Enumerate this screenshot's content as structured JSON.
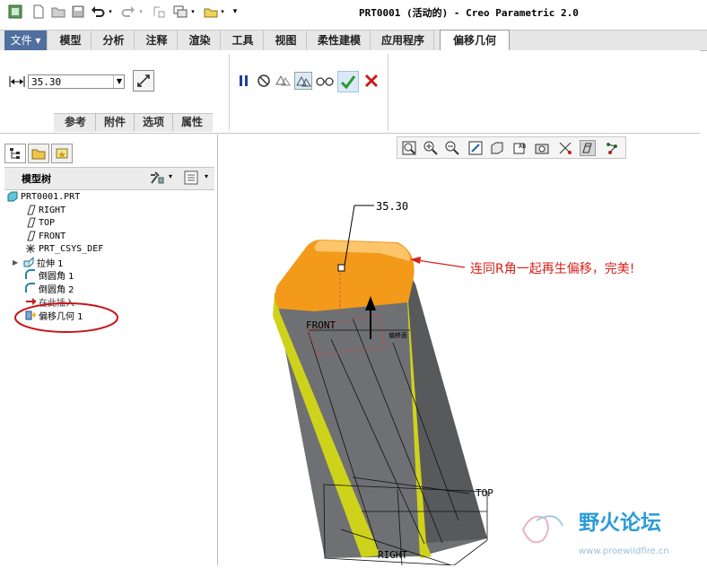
{
  "window": {
    "title": "PRT0001 (活动的) - Creo Parametric 2.0"
  },
  "ribbon_tabs": [
    {
      "label": "文件 ▾"
    },
    {
      "label": "模型"
    },
    {
      "label": "分析"
    },
    {
      "label": "注释"
    },
    {
      "label": "渲染"
    },
    {
      "label": "工具"
    },
    {
      "label": "视图"
    },
    {
      "label": "柔性建模"
    },
    {
      "label": "应用程序"
    },
    {
      "label": "偏移几何"
    }
  ],
  "feature_dashboard": {
    "offset_value": "35.30",
    "sub_tabs": [
      {
        "label": "参考"
      },
      {
        "label": "附件"
      },
      {
        "label": "选项"
      },
      {
        "label": "属性"
      }
    ]
  },
  "model_tree": {
    "title": "模型树",
    "items": [
      {
        "label": "PRT0001.PRT",
        "icon": "part-icon"
      },
      {
        "label": "RIGHT",
        "icon": "datum-plane-icon"
      },
      {
        "label": "TOP",
        "icon": "datum-plane-icon"
      },
      {
        "label": "FRONT",
        "icon": "datum-plane-icon"
      },
      {
        "label": "PRT_CSYS_DEF",
        "icon": "csys-icon"
      },
      {
        "label": "拉伸 1",
        "icon": "extrude-icon"
      },
      {
        "label": "倒圆角 1",
        "icon": "round-icon"
      },
      {
        "label": "倒圆角 2",
        "icon": "round-icon"
      },
      {
        "label": "在此插入",
        "icon": "insert-arrow-icon"
      },
      {
        "label": "偏移几何 1",
        "icon": "offset-feature-icon"
      }
    ]
  },
  "graphics": {
    "dimension_value": "35.30",
    "annotation": "连同R角一起再生偏移，完美!",
    "datum_labels": {
      "front": "FRONT",
      "top": "TOP",
      "right": "RIGHT"
    },
    "surface_label": "偏移面"
  },
  "watermark": {
    "name": "野火论坛",
    "url": "www.proewildfire.cn"
  },
  "colors": {
    "file_tab": "#4f6f9e",
    "offset_surface": "#f39a1a",
    "body_gray": "#6e7073",
    "edge_yellow": "#cfd21a",
    "annotation_red": "#d8211a",
    "confirm_green": "#2b9a2b",
    "cancel_red": "#c81e1e"
  }
}
